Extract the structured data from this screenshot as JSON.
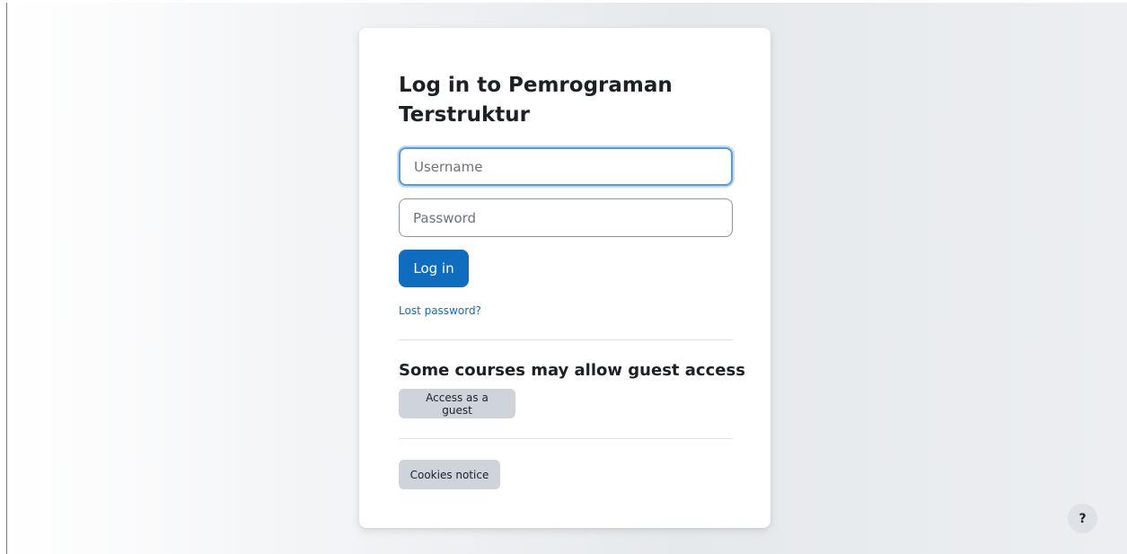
{
  "login": {
    "title": "Log in to Pemrograman Terstruktur",
    "username_placeholder": "Username",
    "password_placeholder": "Password",
    "login_button": "Log in",
    "lost_password": "Lost password?"
  },
  "guest": {
    "heading": "Some courses may allow guest access",
    "button": "Access as a guest"
  },
  "cookies": {
    "button": "Cookies notice"
  },
  "help": {
    "label": "?"
  },
  "colors": {
    "primary": "#0f6cbf",
    "secondary_button": "#ced4da",
    "text": "#1d2125",
    "focus_ring": "#5b9bd5"
  },
  "icons": {
    "help": "question-mark-icon"
  }
}
